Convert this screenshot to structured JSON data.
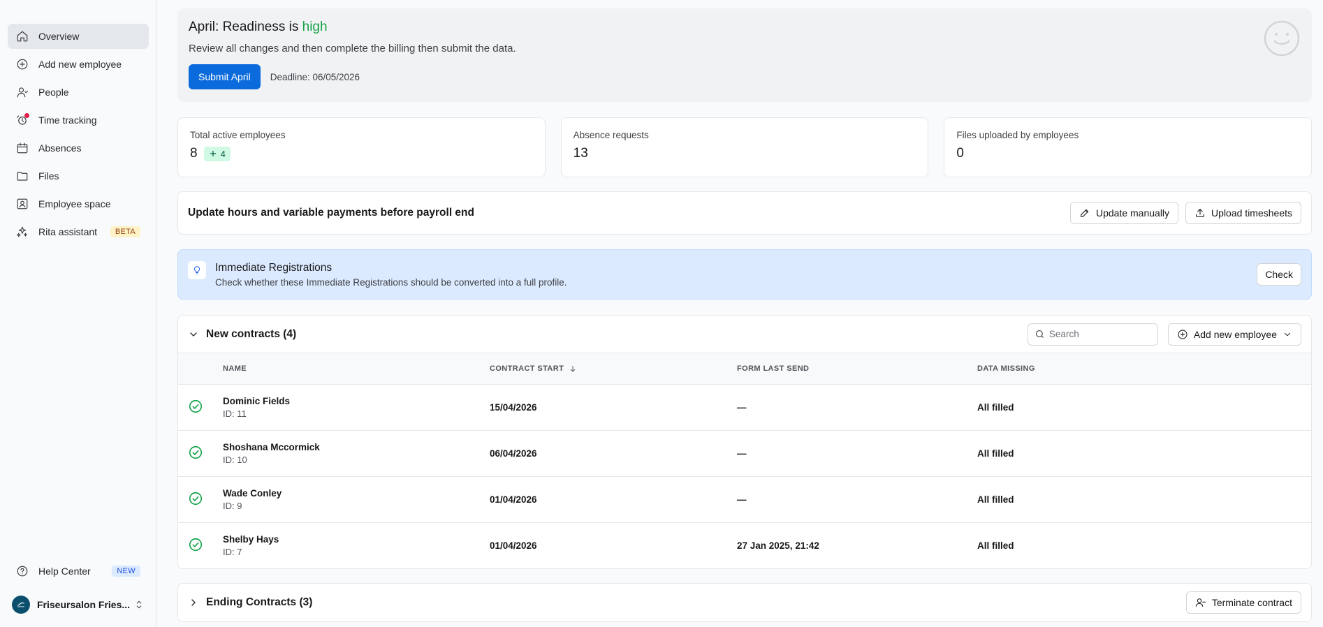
{
  "sidebar": {
    "items": [
      {
        "label": "Overview",
        "icon": "home-icon"
      },
      {
        "label": "Add new employee",
        "icon": "plus-circle-icon"
      },
      {
        "label": "People",
        "icon": "person-icon"
      },
      {
        "label": "Time tracking",
        "icon": "alarm-clock-icon"
      },
      {
        "label": "Absences",
        "icon": "calendar-icon"
      },
      {
        "label": "Files",
        "icon": "folder-icon"
      },
      {
        "label": "Employee space",
        "icon": "id-badge-icon"
      },
      {
        "label": "Rita assistant",
        "icon": "sparkle-icon",
        "badge": "BETA"
      }
    ],
    "help": {
      "label": "Help Center",
      "badge": "NEW"
    },
    "org": {
      "name": "Friseursalon Fries..."
    }
  },
  "hero": {
    "title_prefix": "April: Readiness is ",
    "title_highlight": "high",
    "subtitle": "Review all changes and then complete the billing then submit the data.",
    "submit_label": "Submit April",
    "deadline": "Deadline: 06/05/2026"
  },
  "stats": [
    {
      "title": "Total active employees",
      "value": "8",
      "delta": "4"
    },
    {
      "title": "Absence requests",
      "value": "13"
    },
    {
      "title": "Files uploaded by employees",
      "value": "0"
    }
  ],
  "payroll": {
    "title": "Update hours and variable payments before payroll end",
    "update_manually": "Update manually",
    "upload_timesheets": "Upload timesheets"
  },
  "info": {
    "title": "Immediate Registrations",
    "text": "Check whether these Immediate Registrations should be converted into a full profile.",
    "check_label": "Check"
  },
  "contracts": {
    "title": "New contracts (4)",
    "search_placeholder": "Search",
    "add_button": "Add new employee",
    "columns": [
      "NAME",
      "CONTRACT START",
      "FORM LAST SEND",
      "DATA MISSING"
    ],
    "rows": [
      {
        "name": "Dominic Fields",
        "id": "ID: 11",
        "start": "15/04/2026",
        "form": "—",
        "missing": "All filled"
      },
      {
        "name": "Shoshana Mccormick",
        "id": "ID: 10",
        "start": "06/04/2026",
        "form": "—",
        "missing": "All filled"
      },
      {
        "name": "Wade Conley",
        "id": "ID: 9",
        "start": "01/04/2026",
        "form": "—",
        "missing": "All filled"
      },
      {
        "name": "Shelby Hays",
        "id": "ID: 7",
        "start": "01/04/2026",
        "form": "27 Jan 2025, 21:42",
        "missing": "All filled"
      }
    ]
  },
  "ending": {
    "title": "Ending Contracts (3)",
    "terminate_label": "Terminate contract"
  },
  "colors": {
    "primary": "#0b6bdc",
    "success": "#16a34a",
    "info_bg": "#dbeafe"
  }
}
